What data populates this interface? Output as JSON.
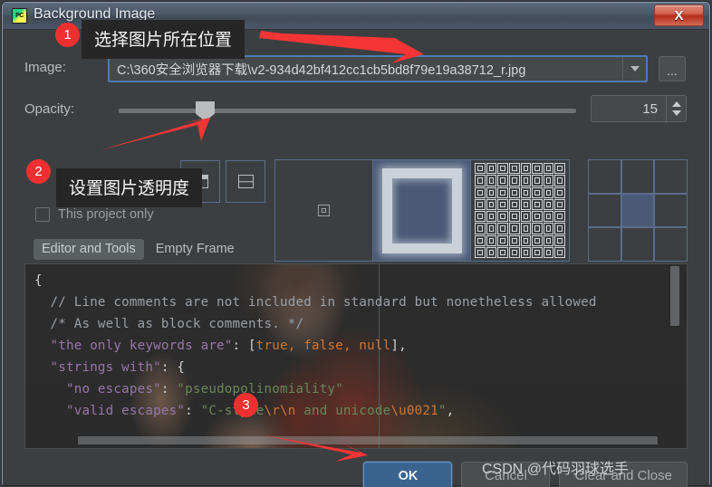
{
  "window": {
    "title": "Background Image",
    "app_icon": "pycharm-icon",
    "close_label": "X"
  },
  "form": {
    "image_label": "Image:",
    "image_value": "C:\\360安全浏览器下载\\v2-934d42bf412cc1cb5bd8f79e19a38712_r.jpg",
    "image_placeholder": "",
    "browse_label": "...",
    "opacity_label": "Opacity:",
    "opacity_value": "15",
    "opacity_percent": 15,
    "this_project_only_label": "This project only",
    "this_project_only_checked": false
  },
  "fill_modes": {
    "mini": [
      {
        "name": "split-vertical",
        "icon": "split-vertical-icon"
      },
      {
        "name": "split-horizontal",
        "icon": "split-horizontal-icon"
      }
    ],
    "tiles": [
      {
        "name": "center",
        "icon": "center-icon",
        "selected": false
      },
      {
        "name": "scale",
        "icon": "scale-icon",
        "selected": true
      },
      {
        "name": "tile",
        "icon": "tile-pattern-icon",
        "selected": false
      }
    ],
    "anchor_selected_index": 4
  },
  "tabs": [
    {
      "label": "Editor and Tools",
      "active": true
    },
    {
      "label": "Empty Frame",
      "active": false
    }
  ],
  "preview": {
    "lines": [
      {
        "segments": [
          {
            "cls": "c-brace",
            "t": "{"
          }
        ]
      },
      {
        "segments": [
          {
            "cls": "c-comment",
            "t": "  // Line comments are not included in standard but nonetheless allowed"
          }
        ]
      },
      {
        "segments": [
          {
            "cls": "c-comment",
            "t": "  /* As well as block comments. */"
          }
        ]
      },
      {
        "segments": [
          {
            "cls": "c-key",
            "t": "  \"the only keywords are\""
          },
          {
            "cls": "c-punct",
            "t": ": ["
          },
          {
            "cls": "c-kw",
            "t": "true, false, null"
          },
          {
            "cls": "c-punct",
            "t": "],"
          }
        ]
      },
      {
        "segments": [
          {
            "cls": "c-key",
            "t": "  \"strings with\""
          },
          {
            "cls": "c-punct",
            "t": ": {"
          }
        ]
      },
      {
        "segments": [
          {
            "cls": "c-key",
            "t": "    \"no escapes\""
          },
          {
            "cls": "c-punct",
            "t": ": "
          },
          {
            "cls": "c-str",
            "t": "\"pseudopolinomiality\""
          }
        ]
      },
      {
        "segments": [
          {
            "cls": "c-key",
            "t": "    \"valid escapes\""
          },
          {
            "cls": "c-punct",
            "t": ": "
          },
          {
            "cls": "c-str",
            "t": "\"C-style"
          },
          {
            "cls": "c-esc",
            "t": "\\r\\n"
          },
          {
            "cls": "c-str",
            "t": " and unicode"
          },
          {
            "cls": "c-esc",
            "t": "\\u0021"
          },
          {
            "cls": "c-str",
            "t": "\""
          },
          {
            "cls": "c-punct",
            "t": ","
          }
        ]
      }
    ]
  },
  "buttons": {
    "ok": "OK",
    "cancel": "Cancel",
    "clear_and_close": "Clear and Close"
  },
  "annotations": [
    {
      "num": "1",
      "text": "选择图片所在位置"
    },
    {
      "num": "2",
      "text": "设置图片透明度"
    },
    {
      "num": "3",
      "text": ""
    }
  ],
  "watermark": "CSDN @代码羽球选手",
  "colors": {
    "accent": "#4a5a76",
    "selection_border": "#4b7bb5",
    "annotation_red": "#f03030",
    "dialog_bg": "#3c3f41",
    "editor_bg": "#2b2b2b"
  }
}
